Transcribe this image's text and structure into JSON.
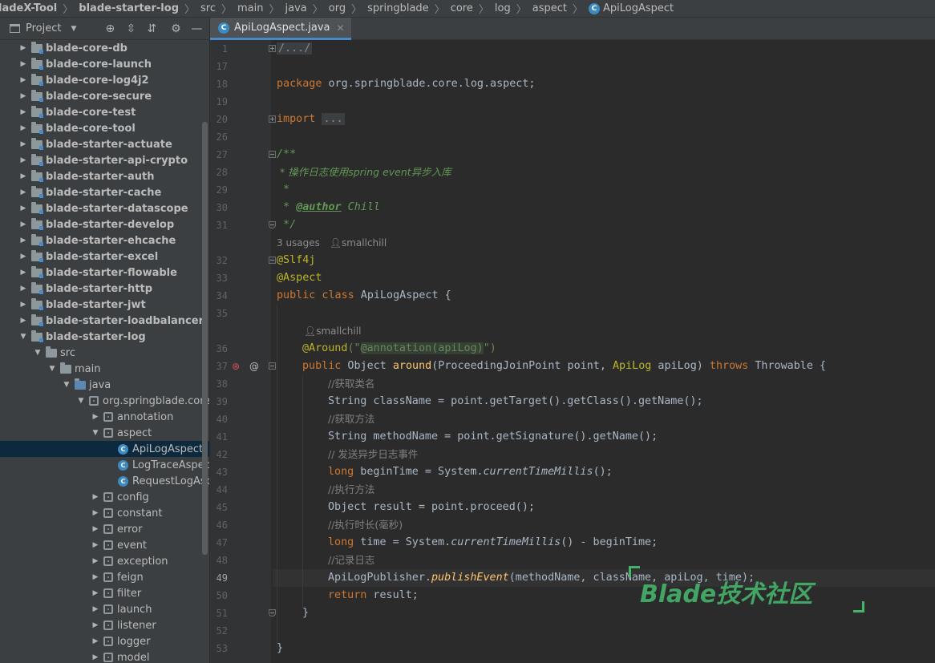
{
  "breadcrumb": {
    "items": [
      "ladeX-Tool",
      "blade-starter-log",
      "src",
      "main",
      "java",
      "org",
      "springblade",
      "core",
      "log",
      "aspect",
      "ApiLogAspect"
    ],
    "class_icon": "C"
  },
  "project_panel": {
    "title": "Project",
    "toolbar_icons": [
      "project-icon",
      "dropdown-icon",
      "locate-icon",
      "expand-all-icon",
      "collapse-all-icon",
      "gear-icon",
      "minimize-icon"
    ],
    "tree": [
      {
        "label": "blade-core-db",
        "type": "module",
        "level": 0,
        "expanded": false
      },
      {
        "label": "blade-core-launch",
        "type": "module",
        "level": 0,
        "expanded": false
      },
      {
        "label": "blade-core-log4j2",
        "type": "module",
        "level": 0,
        "expanded": false
      },
      {
        "label": "blade-core-secure",
        "type": "module",
        "level": 0,
        "expanded": false
      },
      {
        "label": "blade-core-test",
        "type": "module",
        "level": 0,
        "expanded": false
      },
      {
        "label": "blade-core-tool",
        "type": "module",
        "level": 0,
        "expanded": false
      },
      {
        "label": "blade-starter-actuate",
        "type": "module",
        "level": 0,
        "expanded": false
      },
      {
        "label": "blade-starter-api-crypto",
        "type": "module",
        "level": 0,
        "expanded": false
      },
      {
        "label": "blade-starter-auth",
        "type": "module",
        "level": 0,
        "expanded": false
      },
      {
        "label": "blade-starter-cache",
        "type": "module",
        "level": 0,
        "expanded": false
      },
      {
        "label": "blade-starter-datascope",
        "type": "module",
        "level": 0,
        "expanded": false
      },
      {
        "label": "blade-starter-develop",
        "type": "module",
        "level": 0,
        "expanded": false
      },
      {
        "label": "blade-starter-ehcache",
        "type": "module",
        "level": 0,
        "expanded": false
      },
      {
        "label": "blade-starter-excel",
        "type": "module",
        "level": 0,
        "expanded": false
      },
      {
        "label": "blade-starter-flowable",
        "type": "module",
        "level": 0,
        "expanded": false
      },
      {
        "label": "blade-starter-http",
        "type": "module",
        "level": 0,
        "expanded": false
      },
      {
        "label": "blade-starter-jwt",
        "type": "module",
        "level": 0,
        "expanded": false
      },
      {
        "label": "blade-starter-loadbalancer",
        "type": "module",
        "level": 0,
        "expanded": false
      },
      {
        "label": "blade-starter-log",
        "type": "module",
        "level": 0,
        "expanded": true
      },
      {
        "label": "src",
        "type": "folder",
        "level": 1,
        "expanded": true
      },
      {
        "label": "main",
        "type": "folder",
        "level": 2,
        "expanded": true
      },
      {
        "label": "java",
        "type": "source",
        "level": 3,
        "expanded": true
      },
      {
        "label": "org.springblade.core.l",
        "type": "package",
        "level": 4,
        "expanded": true
      },
      {
        "label": "annotation",
        "type": "package",
        "level": 5,
        "expanded": false
      },
      {
        "label": "aspect",
        "type": "package",
        "level": 5,
        "expanded": true
      },
      {
        "label": "ApiLogAspect",
        "type": "class",
        "level": 6,
        "selected": true
      },
      {
        "label": "LogTraceAspect",
        "type": "class",
        "level": 6
      },
      {
        "label": "RequestLogAsp",
        "type": "class",
        "level": 6
      },
      {
        "label": "config",
        "type": "package",
        "level": 5,
        "expanded": false
      },
      {
        "label": "constant",
        "type": "package",
        "level": 5,
        "expanded": false
      },
      {
        "label": "error",
        "type": "package",
        "level": 5,
        "expanded": false
      },
      {
        "label": "event",
        "type": "package",
        "level": 5,
        "expanded": false
      },
      {
        "label": "exception",
        "type": "package",
        "level": 5,
        "expanded": false
      },
      {
        "label": "feign",
        "type": "package",
        "level": 5,
        "expanded": false
      },
      {
        "label": "filter",
        "type": "package",
        "level": 5,
        "expanded": false
      },
      {
        "label": "launch",
        "type": "package",
        "level": 5,
        "expanded": false
      },
      {
        "label": "listener",
        "type": "package",
        "level": 5,
        "expanded": false
      },
      {
        "label": "logger",
        "type": "package",
        "level": 5,
        "expanded": false
      },
      {
        "label": "model",
        "type": "package",
        "level": 5,
        "expanded": false
      }
    ]
  },
  "editor": {
    "tab_label": "ApiLogAspect.java",
    "tab_icon": "C",
    "current_line": "49",
    "line_numbers": [
      "1",
      "17",
      "18",
      "19",
      "20",
      "26",
      "27",
      "28",
      "29",
      "30",
      "31",
      "32",
      "33",
      "34",
      "35",
      "36",
      "37",
      "38",
      "39",
      "40",
      "41",
      "42",
      "43",
      "44",
      "45",
      "46",
      "47",
      "48",
      "49",
      "50",
      "51",
      "52",
      "53"
    ],
    "hints": {
      "usages": "3 usages",
      "author_class": "smallchill",
      "author_method": "smallchill"
    },
    "code": {
      "l1_fold": "/.../",
      "l18_kw": "package",
      "l18_rest": " org.springblade.core.log.aspect;",
      "l20_kw": "import",
      "l20_fold": "...",
      "l27": "/**",
      "l28": " * 操作日志使用spring event异步入库",
      "l29": " *",
      "l30_pre": " * ",
      "l30_tag": "@author",
      "l30_val": " Chill",
      "l31": " */",
      "l32": "@Slf4j",
      "l33": "@Aspect",
      "l34_kw": "public class",
      "l34_rest": " ApiLogAspect {",
      "l36_ann": "@Around",
      "l36_p1": "(\"",
      "l36_inner": "@annotation(apiLog)",
      "l36_p2": "\")",
      "l37_kw": "public",
      "l37_a": " Object ",
      "l37_meth": "around",
      "l37_b": "(ProceedingJoinPoint point, ",
      "l37_type": "ApiLog",
      "l37_c": " apiLog) ",
      "l37_kw2": "throws",
      "l37_d": " Throwable {",
      "l38": "//获取类名",
      "l39": "String className = point.getTarget().getClass().getName();",
      "l40": "//获取方法",
      "l41": "String methodName = point.getSignature().getName();",
      "l42": "// 发送异步日志事件",
      "l43_kw": "long",
      "l43_a": " beginTime = System.",
      "l43_stat": "currentTimeMillis",
      "l43_b": "();",
      "l44": "//执行方法",
      "l45": "Object result = point.proceed();",
      "l46": "//执行时长(毫秒)",
      "l47_kw": "long",
      "l47_a": " time = System.",
      "l47_stat": "currentTimeMillis",
      "l47_b": "() - beginTime;",
      "l48": "//记录日志",
      "l49_a": "ApiLogPublisher.",
      "l49_stat": "publishEvent",
      "l49_b": "(methodName, className, apiLog, time);",
      "l50_kw": "return",
      "l50_rest": " result;",
      "l51": "}",
      "l53": "}"
    }
  },
  "watermark": {
    "text": "Blade技术社区"
  }
}
